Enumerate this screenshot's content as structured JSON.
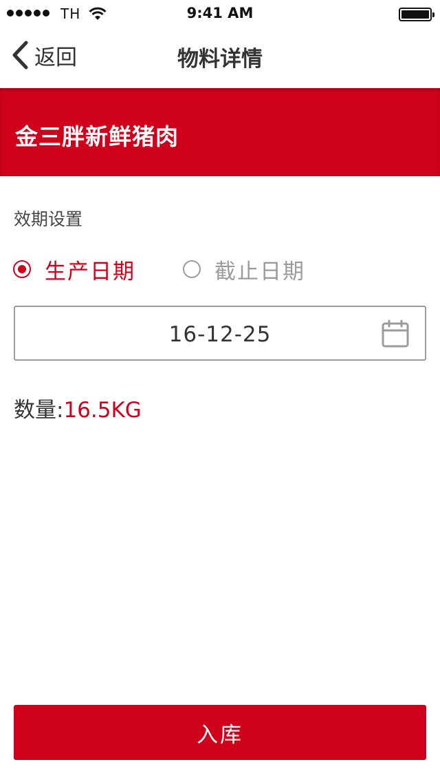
{
  "status_bar": {
    "carrier": "TH",
    "time": "9:41 AM"
  },
  "nav": {
    "back_label": "返回",
    "title": "物料详情"
  },
  "product": {
    "name": "金三胖新鲜猪肉"
  },
  "expiry_settings": {
    "label": "效期设置",
    "options": [
      {
        "label": "生产日期",
        "selected": true
      },
      {
        "label": "截止日期",
        "selected": false
      }
    ],
    "date_value": "16-12-25"
  },
  "quantity": {
    "label": "数量:",
    "value": "16.5KG"
  },
  "actions": {
    "submit_label": "入库"
  },
  "colors": {
    "accent": "#d0021b",
    "muted": "#9b9b9b",
    "text": "#333333"
  },
  "icons": [
    "signal-icon",
    "wifi-icon",
    "battery-icon",
    "back-chevron-icon",
    "calendar-icon"
  ]
}
